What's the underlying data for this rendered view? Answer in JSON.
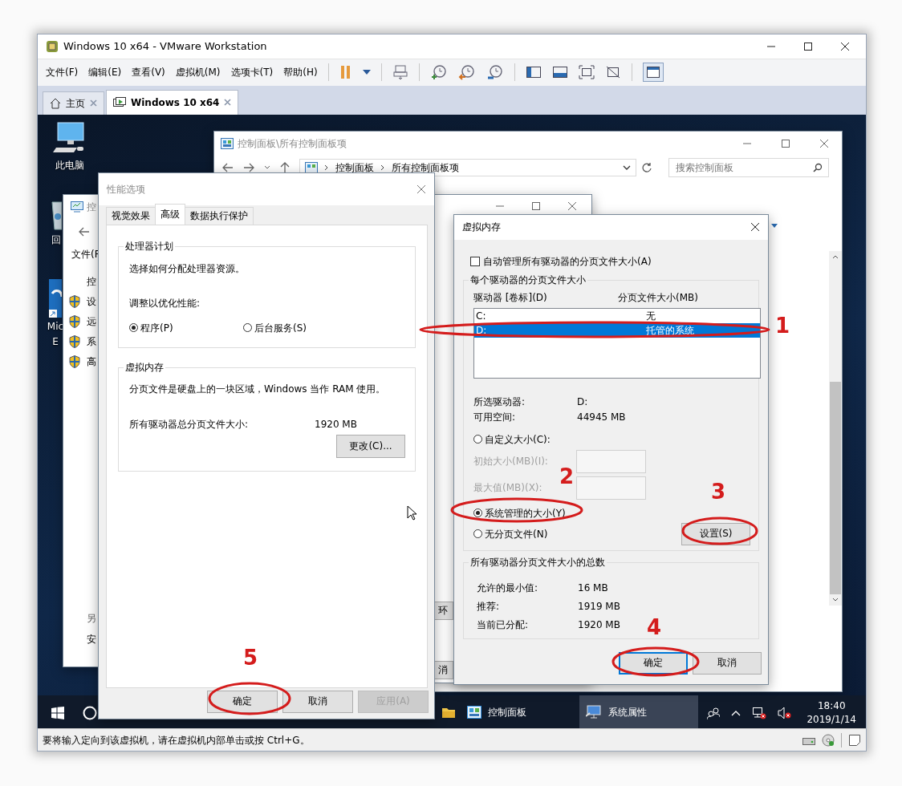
{
  "window": {
    "title": "Windows 10 x64 - VMware Workstation"
  },
  "menu": [
    "文件(F)",
    "编辑(E)",
    "查看(V)",
    "虚拟机(M)",
    "选项卡(T)",
    "帮助(H)"
  ],
  "tabs": [
    {
      "label": "主页",
      "selected": false
    },
    {
      "label": "Windows 10 x64",
      "selected": true
    }
  ],
  "desktop_icons": [
    {
      "kind": "computer",
      "lines": [
        "此电脑"
      ]
    },
    {
      "kind": "recycle-bin",
      "lines": [
        "回"
      ]
    },
    {
      "kind": "edge",
      "lines": [
        "Mic",
        "E"
      ]
    }
  ],
  "control_panel": {
    "title": "控制面板\\所有控制面板项",
    "breadcrumb": [
      "控制面板",
      "所有控制面板项"
    ],
    "search_placeholder": "搜索控制面板"
  },
  "system_properties": {
    "title": "控",
    "menu_label": "文件(F",
    "home_link": "控",
    "tasks": [
      "设",
      "远",
      "系",
      "高"
    ],
    "see_also": "另",
    "see_also_items": [
      "安"
    ]
  },
  "middle_window": {
    "buttons": [
      "环",
      "消"
    ]
  },
  "performance_options": {
    "title": "性能选项",
    "tabs": [
      {
        "label": "视觉效果",
        "selected": false
      },
      {
        "label": "高级",
        "selected": true
      },
      {
        "label": "数据执行保护",
        "selected": false
      }
    ],
    "processor": {
      "legend": "处理器计划",
      "description": "选择如何分配处理器资源。",
      "prompt": "调整以优化性能:",
      "options": [
        {
          "label": "程序(P)",
          "selected": true
        },
        {
          "label": "后台服务(S)",
          "selected": false
        }
      ]
    },
    "virtual_memory": {
      "legend": "虚拟内存",
      "description": "分页文件是硬盘上的一块区域，Windows 当作 RAM 使用。",
      "total_label": "所有驱动器总分页文件大小:",
      "total_value": "1920 MB",
      "change_button": "更改(C)..."
    },
    "buttons": [
      {
        "label": "确定",
        "disabled": false
      },
      {
        "label": "取消",
        "disabled": false
      },
      {
        "label": "应用(A)",
        "disabled": true
      }
    ]
  },
  "virtual_memory": {
    "title": "虚拟内存",
    "auto_manage": {
      "label": "自动管理所有驱动器的分页文件大小(A)",
      "checked": false
    },
    "per_drive": {
      "legend": "每个驱动器的分页文件大小",
      "columns": [
        "驱动器 [卷标](D)",
        "分页文件大小(MB)"
      ],
      "rows": [
        {
          "drive": "C:",
          "size": "无",
          "selected": false
        },
        {
          "drive": "D:",
          "size": "托管的系统",
          "selected": true
        }
      ],
      "selected_drive": {
        "label": "所选驱动器:",
        "value": "D:"
      },
      "free_space": {
        "label": "可用空间:",
        "value": "44945 MB"
      },
      "options": [
        {
          "label": "自定义大小(C):",
          "selected": false
        },
        {
          "label": "系统管理的大小(Y)",
          "selected": true
        },
        {
          "label": "无分页文件(N)",
          "selected": false
        }
      ],
      "fields": [
        {
          "label": "初始大小(MB)(I):",
          "disabled": true
        },
        {
          "label": "最大值(MB)(X):",
          "disabled": true
        }
      ],
      "set_button": "设置(S)"
    },
    "totals": {
      "legend": "所有驱动器分页文件大小的总数",
      "rows": [
        {
          "label": "允许的最小值:",
          "value": "16 MB"
        },
        {
          "label": "推荐:",
          "value": "1919 MB"
        },
        {
          "label": "当前已分配:",
          "value": "1920 MB"
        }
      ]
    },
    "buttons": [
      {
        "label": "确定",
        "default": true
      },
      {
        "label": "取消",
        "default": false
      }
    ]
  },
  "taskbar": {
    "items": [
      {
        "label": "控制面板",
        "selected": false
      },
      {
        "label": "系统属性",
        "selected": true
      }
    ],
    "time": "18:40",
    "date": "2019/1/14"
  },
  "status_bar": {
    "text": "要将输入定向到该虚拟机，请在虚拟机内部单击或按 Ctrl+G。"
  },
  "annotations": [
    {
      "number": "1"
    },
    {
      "number": "2"
    },
    {
      "number": "3"
    },
    {
      "number": "4"
    },
    {
      "number": "5"
    }
  ]
}
